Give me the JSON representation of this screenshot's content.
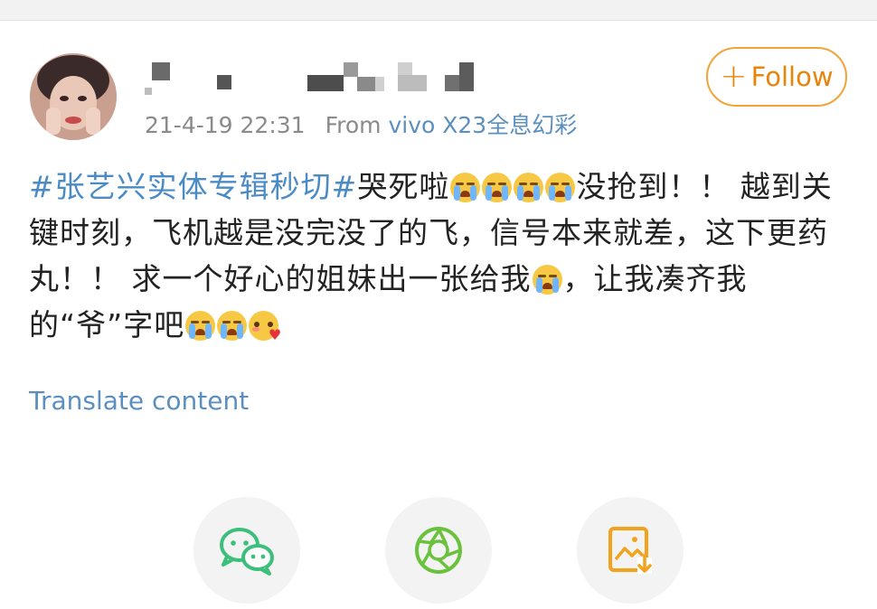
{
  "post": {
    "timestamp": "21-4-19 22:31",
    "source_prefix": "From",
    "source_device": "vivo X23全息幻彩",
    "follow_label": "Follow",
    "follow_icon": "plus-icon",
    "content": {
      "hashtag": "#张艺兴实体专辑秒切#",
      "t1": "哭死啦",
      "t2": "没抢到！！ 越到关键时刻，飞机越是没完没了的飞，信号本来就差，这下更药丸！！ 求一个好心的姐妹出一张给我",
      "t3": "，让我凑齐我的“爷”字吧"
    },
    "translate_label": "Translate content"
  },
  "share_actions": [
    {
      "icon": "wechat-icon",
      "color": "#3bbf7a"
    },
    {
      "icon": "moments-icon",
      "color": "#6ac13b"
    },
    {
      "icon": "save-image-icon",
      "color": "#f2a21b"
    }
  ]
}
